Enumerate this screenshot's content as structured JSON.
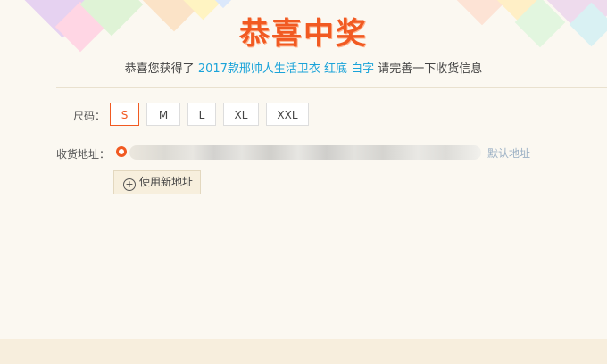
{
  "title": "恭喜中奖",
  "subtitle": {
    "prefix": "恭喜您获得了 ",
    "product": "2017款邢帅人生活卫衣 红底 白字",
    "suffix": " 请完善一下收货信息"
  },
  "size": {
    "label": "尺码：",
    "options": [
      "S",
      "M",
      "L",
      "XL",
      "XXL"
    ],
    "selected": "S"
  },
  "address": {
    "label": "收货地址：",
    "default_label": "默认地址",
    "new_address_button": "使用新地址",
    "new_address_icon": "plus-circle-icon"
  },
  "colors": {
    "accent": "#f15a22",
    "link": "#1aa3d9",
    "background": "#fbf8f1"
  }
}
